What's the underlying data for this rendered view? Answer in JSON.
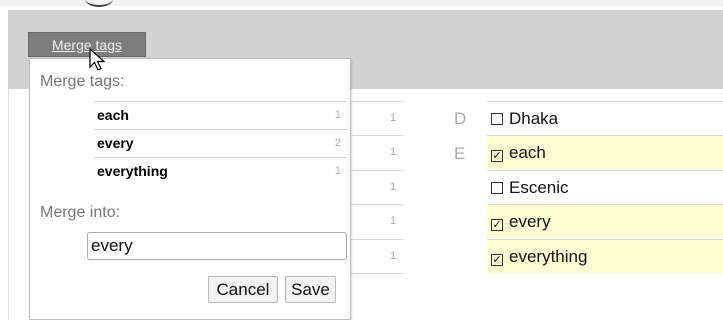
{
  "toolbar": {
    "merge_button_label": "Merge tags"
  },
  "background_counts": [
    "1",
    "1",
    "1",
    "1",
    "1"
  ],
  "index_letters": [
    "D",
    "E"
  ],
  "tags": [
    {
      "label": "Dhaka",
      "checked": false
    },
    {
      "label": "each",
      "checked": true
    },
    {
      "label": "Escenic",
      "checked": false
    },
    {
      "label": "every",
      "checked": true
    },
    {
      "label": "everything",
      "checked": true
    }
  ],
  "popup": {
    "title": "Merge tags:",
    "merge_items": [
      {
        "name": "each",
        "count": "1"
      },
      {
        "name": "every",
        "count": "2"
      },
      {
        "name": "everything",
        "count": "1"
      }
    ],
    "merge_into_label": "Merge into:",
    "merge_into_value": "every",
    "cancel_label": "Cancel",
    "save_label": "Save"
  },
  "icons": {
    "cursor": "mouse-pointer-icon",
    "checkbox": "checkbox-icon"
  }
}
